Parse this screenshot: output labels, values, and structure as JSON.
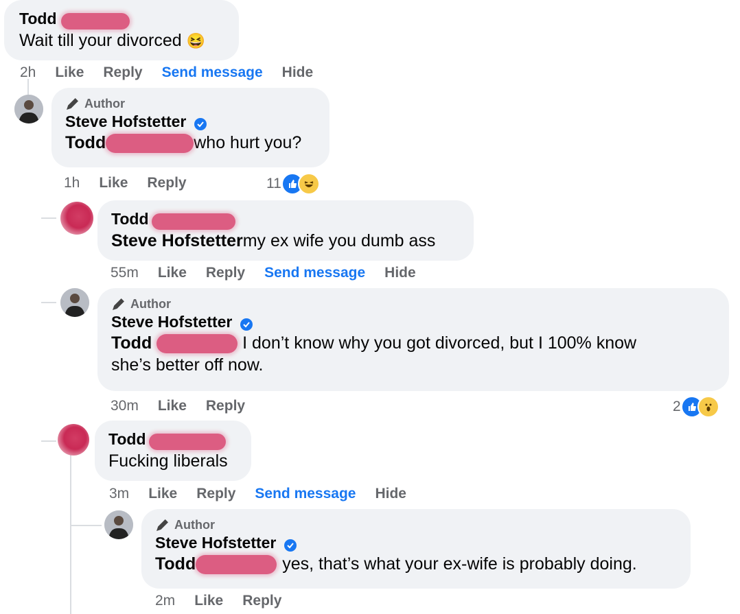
{
  "comments": [
    {
      "name": "Todd",
      "text": "Wait till your divorced",
      "emoji": "😆",
      "time": "2h",
      "actions": [
        "Like",
        "Reply",
        "Send message",
        "Hide"
      ]
    },
    {
      "badge": "Author",
      "name": "Steve Hofstetter",
      "mention": "Todd",
      "text": "who hurt you?",
      "time": "1h",
      "actions": [
        "Like",
        "Reply"
      ],
      "reaction_count": "11"
    },
    {
      "name": "Todd",
      "mention": "Steve Hofstetter",
      "text": "my ex wife you dumb ass",
      "time": "55m",
      "actions": [
        "Like",
        "Reply",
        "Send message",
        "Hide"
      ]
    },
    {
      "badge": "Author",
      "name": "Steve Hofstetter",
      "mention": "Todd",
      "text_line1": "I don’t know why you got divorced, but I 100% know",
      "text_line2": "she’s better off now.",
      "time": "30m",
      "actions": [
        "Like",
        "Reply"
      ],
      "reaction_count": "2"
    },
    {
      "name": "Todd",
      "text": "Fucking liberals",
      "time": "3m",
      "actions": [
        "Like",
        "Reply",
        "Send message",
        "Hide"
      ]
    },
    {
      "badge": "Author",
      "name": "Steve Hofstetter",
      "mention": "Todd",
      "text": "yes, that’s what your ex-wife is probably doing.",
      "time": "2m",
      "actions": [
        "Like",
        "Reply"
      ]
    }
  ],
  "colors": {
    "bubble": "#f0f2f5",
    "link": "#1877f2",
    "meta": "#65676b",
    "redaction": "#d9446f"
  },
  "icons": [
    "pencil-icon",
    "verified-badge-icon",
    "like-reaction-icon",
    "haha-reaction-icon",
    "wow-reaction-icon"
  ]
}
